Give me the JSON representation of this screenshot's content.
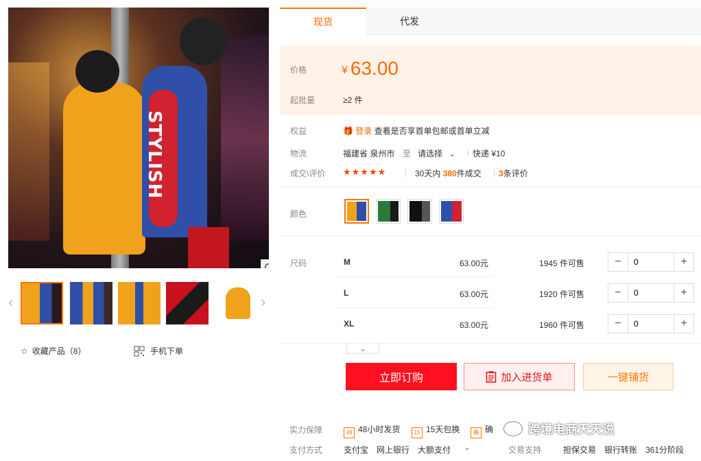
{
  "gallery": {
    "main_image_text": "STYLISH",
    "collect_label": "收藏产品（8）",
    "mobile_label": "手机下单"
  },
  "tabs": [
    {
      "label": "现货"
    },
    {
      "label": "代发"
    }
  ],
  "price": {
    "label": "价格",
    "currency": "¥",
    "value": "63.00"
  },
  "moq": {
    "label": "起批量",
    "value": "≥2 件"
  },
  "benefits": {
    "label": "权益",
    "login_link": "登录",
    "text": "查看是否享首单包邮或首单立减"
  },
  "logistics": {
    "label": "物流",
    "from": "福建省 泉州市",
    "to_word": "至",
    "select_label": "请选择",
    "express": "快递 ¥10"
  },
  "deals": {
    "label": "成交\\评价",
    "stars": "★★★★★",
    "prefix": "30天内",
    "count": "380",
    "suffix": "件成交",
    "reviews": "3",
    "reviews_suffix": "条评价"
  },
  "color": {
    "label": "颜色"
  },
  "size": {
    "label": "尺码",
    "rows": [
      {
        "name": "M",
        "price": "63.00元",
        "stock": "1945 件可售",
        "qty": "0"
      },
      {
        "name": "L",
        "price": "63.00元",
        "stock": "1920 件可售",
        "qty": "0"
      },
      {
        "name": "XL",
        "price": "63.00元",
        "stock": "1960 件可售",
        "qty": "0"
      }
    ]
  },
  "actions": {
    "order": "立即订购",
    "cart": "加入进货单",
    "distribute": "一键铺货"
  },
  "guarantee": {
    "label": "实力保障",
    "items": [
      "48小时发货",
      "15天包换",
      "确"
    ],
    "icons": [
      "48",
      "15",
      "确"
    ]
  },
  "payment": {
    "label": "支付方式",
    "methods": "支付宝　网上银行　大额支付",
    "trade_label": "交易支持",
    "trade_methods": "担保交易　银行转账　361分阶段"
  },
  "watermark": {
    "text": "跨境电商天天说"
  },
  "colors": {
    "accent": "#ff6600",
    "buy": "#ff0f1f"
  }
}
